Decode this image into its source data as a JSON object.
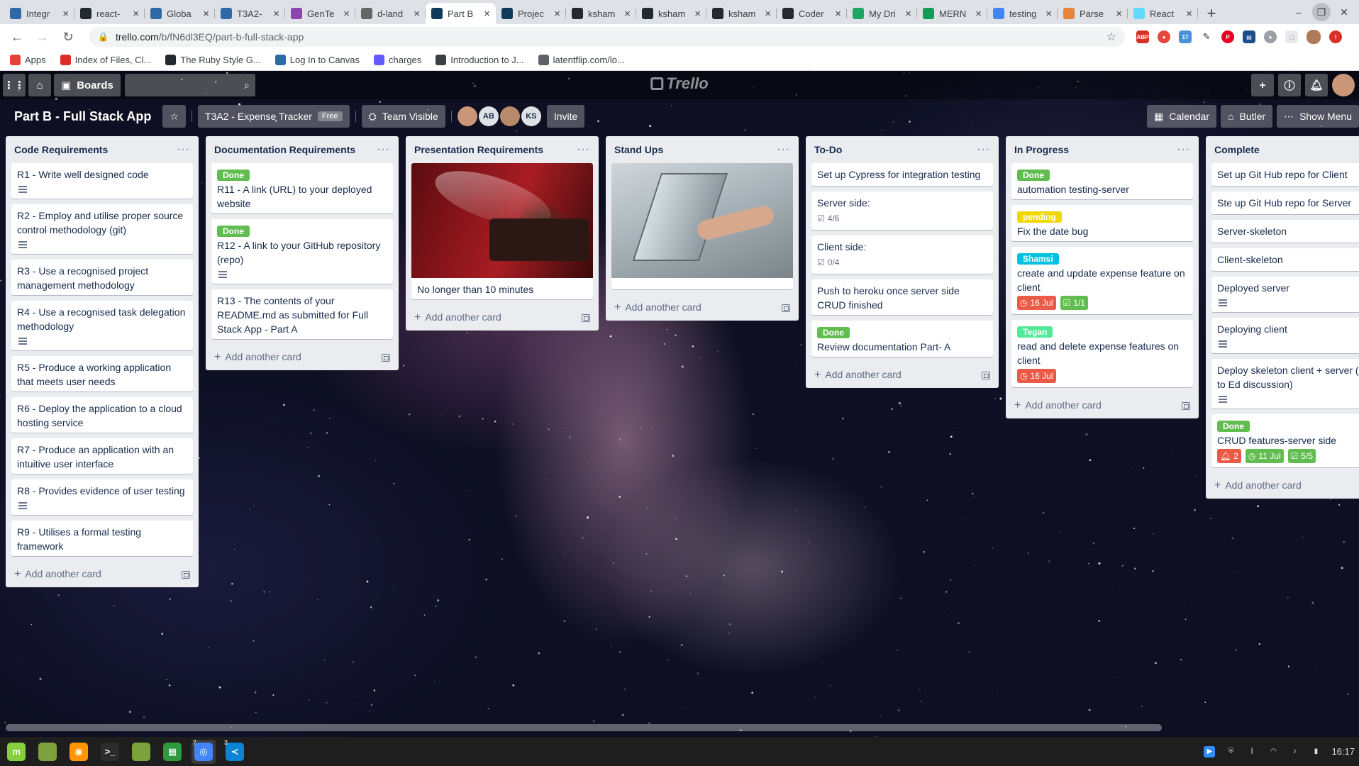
{
  "browser": {
    "tabs": [
      {
        "label": "Integr",
        "icon": "canvas-icon",
        "color": "#2d6aa6",
        "active": false
      },
      {
        "label": "react-",
        "icon": "github-icon",
        "color": "#24292e",
        "active": false
      },
      {
        "label": "Globa",
        "icon": "canvas-icon",
        "color": "#2d6aa6",
        "active": false
      },
      {
        "label": "T3A2-",
        "icon": "canvas-icon",
        "color": "#2d6aa6",
        "active": false
      },
      {
        "label": "GenTe",
        "icon": "ed-icon",
        "color": "#8e44ad",
        "active": false
      },
      {
        "label": "d-land",
        "icon": "smiley-icon",
        "color": "#666666",
        "active": false
      },
      {
        "label": "Part B",
        "icon": "trello-icon",
        "color": "#0f3a5c",
        "active": true
      },
      {
        "label": "Projec",
        "icon": "trello-icon",
        "color": "#0f3a5c",
        "active": false
      },
      {
        "label": "ksham",
        "icon": "github-icon",
        "color": "#24292e",
        "active": false
      },
      {
        "label": "ksham",
        "icon": "github-icon",
        "color": "#24292e",
        "active": false
      },
      {
        "label": "ksham",
        "icon": "github-icon",
        "color": "#24292e",
        "active": false
      },
      {
        "label": "Coder",
        "icon": "github-icon",
        "color": "#24292e",
        "active": false
      },
      {
        "label": "My Dri",
        "icon": "drive-icon",
        "color": "#1fa463",
        "active": false
      },
      {
        "label": "MERN",
        "icon": "sheets-icon",
        "color": "#0f9d58",
        "active": false
      },
      {
        "label": "testing",
        "icon": "google-icon",
        "color": "#4285f4",
        "active": false
      },
      {
        "label": "Parse",
        "icon": "parse-icon",
        "color": "#e8833a",
        "active": false
      },
      {
        "label": "React",
        "icon": "react-icon",
        "color": "#61dafb",
        "active": false
      }
    ],
    "url_host": "trello.com",
    "url_path": "/b/fN6dl3EQ/part-b-full-stack-app",
    "bookmarks": [
      {
        "label": "Apps",
        "icon": "apps-grid-icon",
        "color": "#e94235"
      },
      {
        "label": "Index of Files, Cl...",
        "icon": "folder-icon",
        "color": "#d93025"
      },
      {
        "label": "The Ruby Style G...",
        "icon": "github-icon",
        "color": "#24292e"
      },
      {
        "label": "Log In to Canvas",
        "icon": "canvas-icon",
        "color": "#2d6aa6"
      },
      {
        "label": "charges",
        "icon": "stripe-icon",
        "color": "#635bff"
      },
      {
        "label": "Introduction to J...",
        "icon": "document-icon",
        "color": "#3c4043"
      },
      {
        "label": "latentflip.com/lo...",
        "icon": "globe-icon",
        "color": "#5f6368"
      }
    ]
  },
  "trello": {
    "topbar": {
      "boards_label": "Boards",
      "logo_text": "Trello"
    },
    "board": {
      "name": "Part B - Full Stack App",
      "team_name": "T3A2 - Expense Tracker",
      "team_plan": "Free",
      "visibility": "Team Visible",
      "members": [
        "AB",
        "KS"
      ],
      "invite_label": "Invite",
      "calendar_label": "Calendar",
      "butler_label": "Butler",
      "menu_label": "Show Menu"
    },
    "add_card_label": "Add another card",
    "lists": [
      {
        "title": "Code Requirements",
        "cards": [
          {
            "title": "R1 - Write well designed code",
            "desc": true
          },
          {
            "title": "R2 - Employ and utilise proper source control methodology (git)",
            "desc": true
          },
          {
            "title": "R3 - Use a recognised project management methodology",
            "desc": false
          },
          {
            "title": "R4 - Use a recognised task delegation methodology",
            "desc": true
          },
          {
            "title": "R5 - Produce a working application that meets user needs",
            "desc": false
          },
          {
            "title": "R6 - Deploy the application to a cloud hosting service",
            "desc": false
          },
          {
            "title": "R7 - Produce an application with an intuitive user interface",
            "desc": false
          },
          {
            "title": "R8 - Provides evidence of user testing",
            "desc": true
          },
          {
            "title": "R9 - Utilises a formal testing framework",
            "desc": false
          }
        ]
      },
      {
        "title": "Documentation Requirements",
        "cards": [
          {
            "label": "Done",
            "label_color": "#61bd4f",
            "title": "R11 - A link (URL) to your deployed website",
            "desc": false
          },
          {
            "label": "Done",
            "label_color": "#61bd4f",
            "title": "R12 - A link to your GitHub repository (repo)",
            "desc": true
          },
          {
            "title": "R13 - The contents of your README.md as submitted for Full Stack App - Part A",
            "desc": false
          }
        ]
      },
      {
        "title": "Presentation Requirements",
        "cards": [
          {
            "cover": "projector",
            "title": "No longer than 10 minutes",
            "desc": false
          }
        ]
      },
      {
        "title": "Stand Ups",
        "cards": [
          {
            "cover": "laptop",
            "title": "",
            "desc": false
          }
        ]
      },
      {
        "title": "To-Do",
        "cards": [
          {
            "title": "Set up Cypress for integration testing",
            "desc": false
          },
          {
            "title": "Server side:",
            "checklist": "4/6",
            "desc": false
          },
          {
            "title": "Client side:",
            "checklist": "0/4",
            "desc": false
          },
          {
            "title": "Push to heroku once server side CRUD finished",
            "desc": false
          },
          {
            "label": "Done",
            "label_color": "#61bd4f",
            "title": "Review documentation Part- A",
            "desc": false
          }
        ]
      },
      {
        "title": "In Progress",
        "cards": [
          {
            "label": "Done",
            "label_color": "#61bd4f",
            "title": "automation testing-server",
            "desc": false
          },
          {
            "label": "pending",
            "label_color": "#f2d600",
            "title": "Fix the date bug",
            "desc": false
          },
          {
            "label": "Shamsi",
            "label_color": "#00c2e0",
            "title": "create and update expense feature on client",
            "due": "16 Jul",
            "due_style": "red",
            "checklist": "1/1",
            "checklist_style": "green",
            "desc": false
          },
          {
            "label": "Tegan",
            "label_color": "#51e898",
            "title": "read and delete expense features on client",
            "due": "16 Jul",
            "due_style": "red",
            "desc": false
          }
        ]
      },
      {
        "title": "Complete",
        "cards": [
          {
            "title": "Set up Git Hub repo for Client",
            "desc": false
          },
          {
            "title": "Ste up Git Hub repo for Server",
            "desc": false
          },
          {
            "title": "Server-skeleton",
            "desc": false
          },
          {
            "title": "Client-skeleton",
            "desc": false
          },
          {
            "title": "Deployed server",
            "desc": true
          },
          {
            "title": "Deploying client",
            "desc": true
          },
          {
            "title": "Deploy skeleton client + server (a links to Ed discussion)",
            "desc": true
          },
          {
            "label": "Done",
            "label_color": "#61bd4f",
            "title": "CRUD features-server side",
            "notify": "2",
            "due": "11 Jul",
            "due_style": "green",
            "checklist": "5/5",
            "checklist_style": "green",
            "desc": false
          }
        ]
      }
    ]
  },
  "taskbar": {
    "apps": [
      {
        "name": "mint-menu-icon",
        "color": "#87cf3e",
        "glyph": "m"
      },
      {
        "name": "files-icon",
        "color": "#7aa33e",
        "glyph": ""
      },
      {
        "name": "firefox-icon",
        "color": "#ff9500",
        "glyph": "◉"
      },
      {
        "name": "terminal-icon",
        "color": "#2b2b2b",
        "glyph": ">_"
      },
      {
        "name": "folder-icon",
        "color": "#7aa33e",
        "glyph": ""
      },
      {
        "name": "spreadsheet-icon",
        "color": "#2e9a3e",
        "glyph": "▦"
      },
      {
        "name": "chrome-icon",
        "color": "#4285f4",
        "glyph": "◎",
        "count": "7",
        "active": true
      },
      {
        "name": "vscode-icon",
        "color": "#0a84d6",
        "glyph": "≺",
        "count": "3"
      }
    ],
    "clock": "16:17"
  }
}
